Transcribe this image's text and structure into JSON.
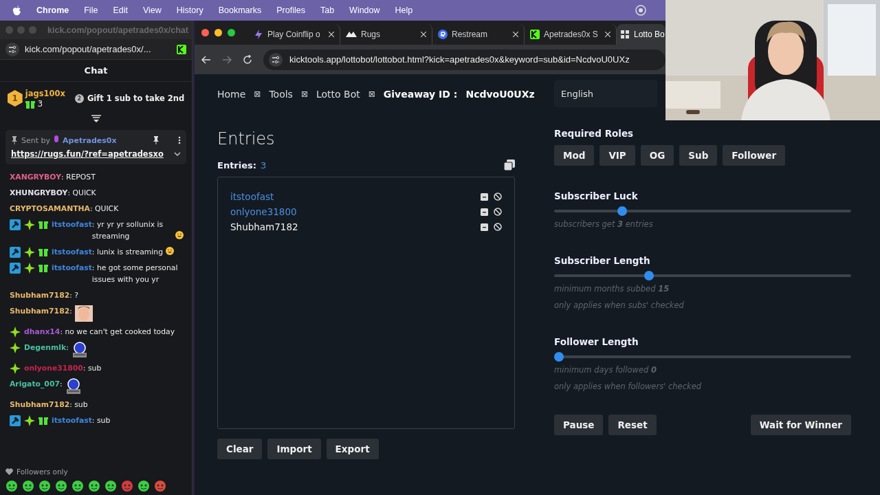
{
  "menu_bar": {
    "app": "Chrome",
    "items": [
      "File",
      "Edit",
      "View",
      "History",
      "Bookmarks",
      "Profiles",
      "Tab",
      "Window",
      "Help"
    ]
  },
  "chat_window": {
    "title": "kick.com/popout/apetrades0x/chat",
    "address": "kick.com/popout/apetrades0x/...",
    "header": "Chat",
    "top_gifter": {
      "rank": "1",
      "name": "jags100x",
      "count": "3"
    },
    "next_spot": {
      "rank": "2",
      "text": "Gift 1 sub to take 2nd"
    },
    "pinned": {
      "label": "Sent by",
      "author": "Apetrades0x",
      "link": "https://rugs.fun/?ref=apetradesxo"
    },
    "messages": [
      {
        "user": "XANGRYBOY",
        "color": "#e0608a",
        "kind": "text",
        "text": ": REPOST",
        "emoji": false
      },
      {
        "user": "XHUNGRYBOY",
        "color": "#e4e2f0",
        "kind": "text",
        "text": ": QUICK",
        "emoji": false
      },
      {
        "user": "CRYPTOSAMANTHA",
        "color": "#e8b96a",
        "kind": "text",
        "text": ": QUICK",
        "emoji": false
      },
      {
        "badges": [
          {
            "kind": "mod"
          },
          {
            "kind": "sparkle"
          },
          {
            "kind": "gift"
          }
        ],
        "user": "itstoofast",
        "color": "#3f86e0",
        "kind": "text",
        "text": ": yr yr yr sollunix is streaming",
        "emoji": true
      },
      {
        "badges": [
          {
            "kind": "mod"
          },
          {
            "kind": "sparkle"
          },
          {
            "kind": "gift"
          }
        ],
        "user": "itstoofast",
        "color": "#3f86e0",
        "kind": "text",
        "text": ": lunix is streaming",
        "emoji": true
      },
      {
        "badges": [
          {
            "kind": "mod"
          },
          {
            "kind": "sparkle"
          },
          {
            "kind": "gift"
          }
        ],
        "user": "itstoofast",
        "color": "#3f86e0",
        "kind": "text",
        "text": ": he got some personal issues with you yr",
        "emoji": false
      },
      {
        "user": "Shubham7182",
        "color": "#e8b96a",
        "kind": "text",
        "text": ": ?",
        "emoji": false
      },
      {
        "user": "Shubham7182",
        "color": "#e8b96a",
        "kind": "portrait",
        "text": ":"
      },
      {
        "badges": [
          {
            "kind": "sparkle"
          }
        ],
        "user": "dhanx14",
        "color": "#a75ad6",
        "kind": "text",
        "text": ": no we can't get cooked today",
        "emoji": false
      },
      {
        "badges": [
          {
            "kind": "sparkle"
          }
        ],
        "user": "Degenmlk",
        "color": "#46c0a0",
        "kind": "robot",
        "text": ":"
      },
      {
        "badges": [
          {
            "kind": "sparkle"
          }
        ],
        "user": "onlyone31800",
        "color": "#c8234e",
        "kind": "text",
        "text": ": sub",
        "emoji": false
      },
      {
        "user": "Arigato_007",
        "color": "#46c0a0",
        "kind": "robot",
        "text": ":"
      },
      {
        "user": "Shubham7182",
        "color": "#e8b96a",
        "kind": "text",
        "text": ": sub",
        "emoji": false
      },
      {
        "badges": [
          {
            "kind": "mod"
          },
          {
            "kind": "sparkle"
          },
          {
            "kind": "gift"
          }
        ],
        "user": "itstoofast",
        "color": "#3f86e0",
        "kind": "text",
        "text": ": sub",
        "emoji": false
      }
    ],
    "footer": "Followers only"
  },
  "browser": {
    "tabs": [
      {
        "title": "Play Coinflip o",
        "kind": "coin",
        "selected": false
      },
      {
        "title": "Rugs",
        "kind": "rugs",
        "selected": false
      },
      {
        "title": "Restream",
        "kind": "restream",
        "selected": false
      },
      {
        "title": "Apetrades0x S",
        "kind": "kick",
        "selected": false
      },
      {
        "title": "Lotto Bo",
        "kind": "grid",
        "selected": true
      }
    ],
    "url": "kicktools.app/lottobot/lottobot.html?kick=apetrades0x&keyword=sub&id=NcdvoU0UXz"
  },
  "page": {
    "breadcrumbs": [
      {
        "kind": "link",
        "text": "Home"
      },
      {
        "kind": "separator",
        "text": "⊠"
      },
      {
        "kind": "link",
        "text": "Tools"
      },
      {
        "kind": "separator",
        "text": "⊠"
      },
      {
        "kind": "link",
        "text": "Lotto Bot"
      },
      {
        "kind": "separator",
        "text": "⊠"
      }
    ],
    "giveaway": {
      "label": "Giveaway ID :",
      "id": "NcdvoU0UXz"
    },
    "entries": {
      "heading": "Entries",
      "count_label": "Entries:",
      "count": "3",
      "items": [
        {
          "name": "itstoofast",
          "highlighted": true
        },
        {
          "name": "onlyone31800",
          "highlighted": true
        },
        {
          "name": "Shubham7182",
          "highlighted": false
        }
      ],
      "buttons": [
        "Clear",
        "Import",
        "Export"
      ]
    },
    "settings": {
      "language": "English",
      "roles_label": "Required Roles",
      "roles": [
        {
          "label": "Mod",
          "selected": false
        },
        {
          "label": "VIP",
          "selected": false
        },
        {
          "label": "OG",
          "selected": false
        },
        {
          "label": "Sub",
          "selected": false
        },
        {
          "label": "Follower",
          "selected": false
        }
      ],
      "sliders": [
        {
          "title": "Subscriber Luck",
          "level": 0.23,
          "notes": [
            "subscribers get **3** entries"
          ]
        },
        {
          "title": "Subscriber Length",
          "level": 0.32,
          "notes": [
            "minimum months subbed **15**",
            "only applies when subs' checked"
          ]
        },
        {
          "title": "Follower Length",
          "level": 0,
          "notes": [
            "minimum days followed **0**",
            "only applies when followers' checked"
          ]
        }
      ],
      "actions": [
        "Pause",
        "Reset"
      ],
      "primary_action": "Wait for Winner"
    }
  }
}
